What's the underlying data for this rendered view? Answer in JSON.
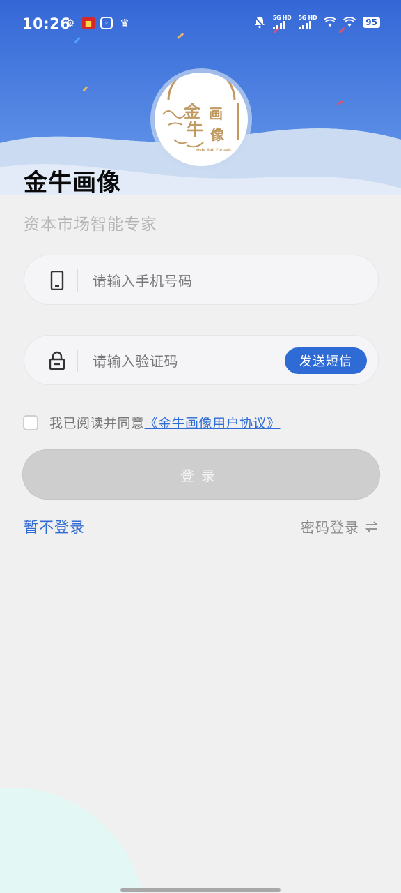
{
  "status_bar": {
    "time": "10:26",
    "network_1_label": "5G HD",
    "network_2_label": "5G HD",
    "battery": "95"
  },
  "app": {
    "logo_chars": [
      "金",
      "牛",
      "画",
      "像"
    ],
    "logo_subtext": "Gold Bull Portrait",
    "title": "金牛画像",
    "subtitle": "资本市场智能专家"
  },
  "form": {
    "phone_placeholder": "请输入手机号码",
    "code_placeholder": "请输入验证码",
    "send_sms_label": "发送短信",
    "agree_text": "我已阅读并同意",
    "agreement_link": "《金牛画像用户协议》",
    "login_label": "登录"
  },
  "footer": {
    "skip_label": "暂不登录",
    "password_login_label": "密码登录"
  },
  "colors": {
    "accent": "#2f6bd4",
    "header_blue": "#3a6fd8",
    "logo_gold": "#c19a62",
    "disabled_button": "#cecece"
  }
}
